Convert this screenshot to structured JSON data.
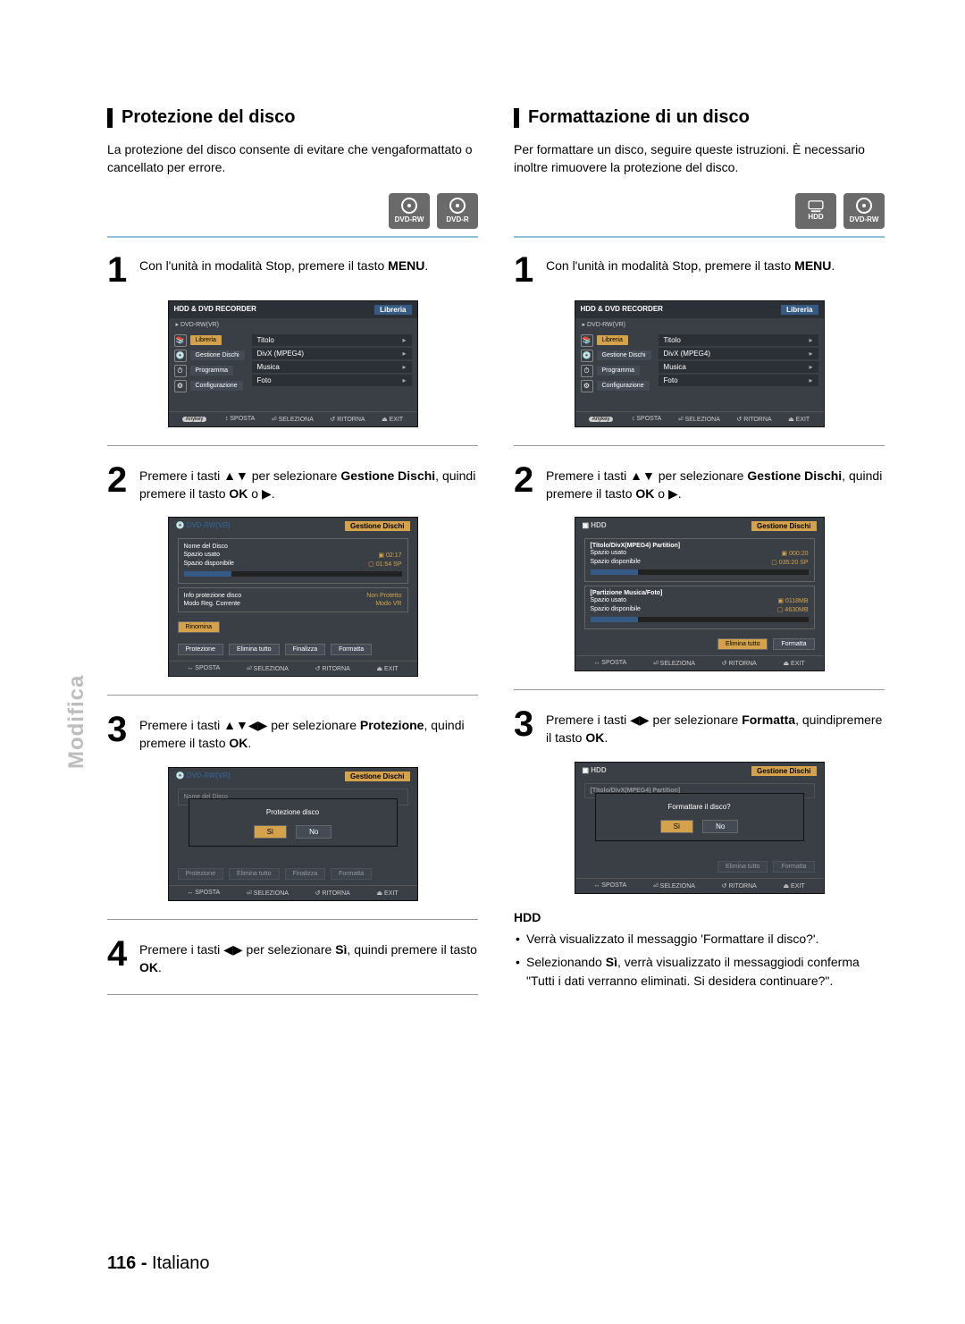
{
  "side_label": "Modifica",
  "footer": {
    "page": "116 -",
    "lang": "Italiano"
  },
  "disc_labels": {
    "hdd": "HDD",
    "dvdrw": "DVD-RW",
    "dvdr": "DVD-R"
  },
  "left": {
    "title": "Protezione del disco",
    "intro": "La protezione del disco consente di evitare che vengaformattato o cancellato per errore.",
    "step1": {
      "pre": "Con l'unità in modalità Stop, premere il tasto ",
      "bold": "MENU",
      "post": "."
    },
    "step2": {
      "pre": "Premere i tasti ▲▼ per selezionare ",
      "b1": "Gestione Dischi",
      "mid": ", quindi premere il tasto ",
      "b2": "OK",
      "post": " o ▶."
    },
    "step3": {
      "pre": "Premere i tasti ▲▼◀▶ per selezionare ",
      "b1": "Protezione",
      "mid": ", quindi premere il tasto ",
      "b2": "OK",
      "post": "."
    },
    "step4": {
      "pre": "Premere i tasti ◀▶ per selezionare ",
      "b1": "Sì",
      "mid": ", quindi premere il tasto ",
      "b2": "OK",
      "post": "."
    }
  },
  "right": {
    "title": "Formattazione di un disco",
    "intro": "Per formattare un disco, seguire queste istruzioni. È necessario inoltre rimuovere la protezione del disco.",
    "step1": {
      "pre": "Con l'unità in modalità Stop, premere il tasto ",
      "bold": "MENU",
      "post": "."
    },
    "step2": {
      "pre": "Premere i tasti ▲▼ per selezionare ",
      "b1": "Gestione Dischi",
      "mid": ", quindi premere il tasto ",
      "b2": "OK",
      "post": " o ▶."
    },
    "step3": {
      "pre": "Premere i tasti ◀▶ per selezionare ",
      "b1": "Formatta",
      "mid": ", quindipremere il tasto ",
      "b2": "OK",
      "post": "."
    },
    "hdd": {
      "title": "HDD",
      "li1": "Verrà visualizzato il messaggio 'Formattare il disco?'.",
      "li2_pre": "Selezionando ",
      "li2_bold": "Sì",
      "li2_post": ", verrà visualizzato il messaggiodi conferma \"Tutti i dati verranno eliminati. Si desidera continuare?\"."
    }
  },
  "osd_menu": {
    "header_left": "HDD & DVD RECORDER",
    "header_right": "Libreria",
    "sub": "DVD-RW(VR)",
    "side": [
      "Libreria",
      "Gestione Dischi",
      "Programma",
      "Configurazione"
    ],
    "list": [
      "Titolo",
      "DivX (MPEG4)",
      "Musica",
      "Foto"
    ],
    "footer": {
      "anykey": "Anykey",
      "sposta": "SPOSTA",
      "seleziona": "SELEZIONA",
      "ritorna": "RITORNA",
      "exit": "EXIT"
    }
  },
  "osd_gd_left": {
    "disc": "DVD-RW(VR)",
    "title": "Gestione Dischi",
    "rows1": [
      [
        "Nome del Disco",
        ""
      ],
      [
        "Spazio usato",
        "02:17"
      ],
      [
        "Spazio disponibile",
        "01:54 SP"
      ]
    ],
    "rows2": [
      [
        "Info protezione disco",
        "Non Protetto"
      ],
      [
        "Modo Reg. Corrente",
        "Modo VR"
      ]
    ],
    "btn_top": "Rinomina",
    "btns": [
      "Protezione",
      "Elimina tutto",
      "Finalizza",
      "Formatta"
    ]
  },
  "osd_gd_right": {
    "disc": "HDD",
    "title": "Gestione Dischi",
    "part1_title": "[Titolo/DivX(MPEG4) Partition]",
    "part1_rows": [
      [
        "Spazio usato",
        "000:20"
      ],
      [
        "Spazio disponibile",
        "035:20 SP"
      ]
    ],
    "part2_title": "[Partizione Musica/Foto]",
    "part2_rows": [
      [
        "Spazio usato",
        "0118MB"
      ],
      [
        "Spazio disponibile",
        "4630MB"
      ]
    ],
    "btns": [
      "Elimina tutto",
      "Formatta"
    ]
  },
  "osd_protect_dialog": {
    "disc": "DVD-RW(VR)",
    "title": "Gestione Dischi",
    "nome": "Nome del Disco",
    "msg": "Protezione disco",
    "yes": "Sì",
    "no": "No",
    "btns": [
      "Protezione",
      "Elimina tutto",
      "Finalizza",
      "Formatta"
    ]
  },
  "osd_format_dialog": {
    "disc": "HDD",
    "title": "Gestione Dischi",
    "part1_title": "[Titolo/DivX(MPEG4) Partition]",
    "msg": "Formattare il disco?",
    "yes": "Sì",
    "no": "No",
    "btns": [
      "Elimina tutto",
      "Formatta"
    ]
  },
  "footer_osd": {
    "sposta": "SPOSTA",
    "seleziona": "SELEZIONA",
    "ritorna": "RITORNA",
    "exit": "EXIT"
  }
}
